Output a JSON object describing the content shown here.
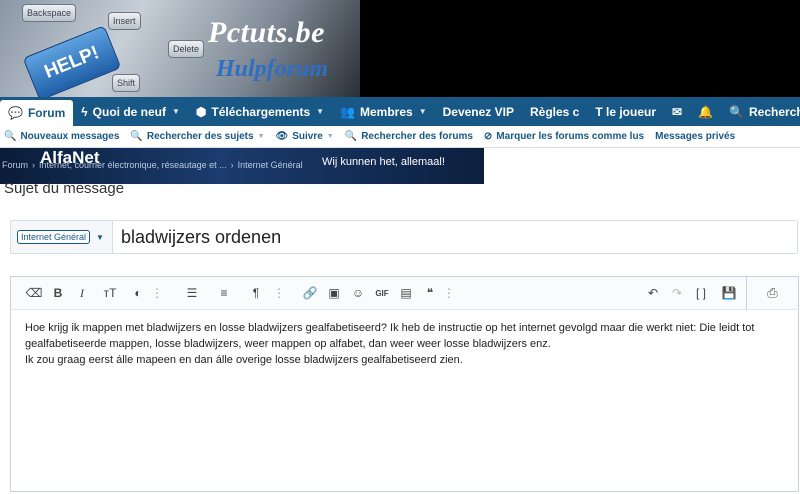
{
  "banner": {
    "keys": [
      "Backspace",
      "Insert",
      "Shift",
      "Delete"
    ],
    "help_key": "HELP!",
    "logo_main": "Pctuts.be",
    "logo_sub": "Hulpforum"
  },
  "nav": {
    "items": [
      {
        "label": "Forum"
      },
      {
        "label": "Quoi de neuf"
      },
      {
        "label": "Téléchargements"
      },
      {
        "label": "Membres"
      },
      {
        "label": "Devenez VIP"
      },
      {
        "label": "Règles c"
      },
      {
        "label": "T le joueur"
      }
    ],
    "search_label": "Recherche"
  },
  "subnav": {
    "items": [
      {
        "label": "Nouveaux messages"
      },
      {
        "label": "Rechercher des sujets"
      },
      {
        "label": "Suivre"
      },
      {
        "label": "Rechercher des forums"
      },
      {
        "label": "Marquer les forums comme lus"
      },
      {
        "label": "Messages privés"
      }
    ]
  },
  "ad": {
    "logo": "AlfaNet",
    "slogan": "Wij kunnen het, allemaal!"
  },
  "breadcrumb": {
    "items": [
      "Forum",
      "Internet, courrier électronique, réseautage et ...",
      "Internet Général"
    ]
  },
  "page_title": "Sujet du message",
  "thread": {
    "prefix": "Internet Général",
    "title": "bladwijzers ordenen"
  },
  "editor": {
    "toolbar": {
      "clear": "⌫",
      "bold": "B",
      "italic": "I",
      "font_size": "тT",
      "color": "◐",
      "more1": "⋮",
      "list": "☰",
      "align": "≡",
      "paragraph": "¶",
      "more2": "⋮",
      "link": "🔗",
      "image": "▣",
      "emoji": "☺",
      "gif": "GIF",
      "media": "▤",
      "quote": "❝",
      "more3": "⋮",
      "undo": "↶",
      "redo": "↷",
      "fullscreen": "[ ]",
      "save": "💾",
      "preview": "⎙"
    },
    "content": {
      "line1": "Hoe krijg ik mappen met bladwijzers en losse bladwijzers gealfabetiseerd? Ik heb de instructie op het internet gevolgd maar die werkt niet: Die leidt tot gealfabetiseerde mappen, losse bladwijzers, weer  mappen op alfabet, dan weer  weer losse bladwijzers enz.",
      "line2": "Ik zou graag eerst álle mapeen en dan álle overige losse bladwijzers gealfabetiseerd zien."
    }
  },
  "colors": {
    "nav_bg": "#185886",
    "link": "#185886",
    "logo_sub": "#2d6fc4"
  }
}
